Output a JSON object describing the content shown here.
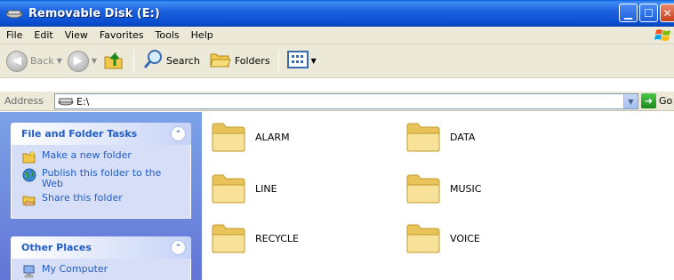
{
  "window": {
    "title": "Removable Disk (E:)",
    "icon": "removable-disk-icon",
    "controls": [
      "minimize",
      "maximize",
      "close"
    ]
  },
  "menu": {
    "items": [
      "File",
      "Edit",
      "View",
      "Favorites",
      "Tools",
      "Help"
    ]
  },
  "toolbar": {
    "back_label": "Back",
    "search_label": "Search",
    "folders_label": "Folders"
  },
  "address": {
    "label": "Address",
    "value": "E:\\",
    "go_label": "Go"
  },
  "left_pane": {
    "file_tasks": {
      "title": "File and Folder Tasks",
      "items": [
        {
          "label": "Make a new folder",
          "icon": "new-folder-icon"
        },
        {
          "label": "Publish this folder to the Web",
          "icon": "globe-icon"
        },
        {
          "label": "Share this folder",
          "icon": "share-folder-icon"
        }
      ]
    },
    "other_places": {
      "title": "Other Places",
      "items": [
        {
          "label": "My Computer",
          "icon": "my-computer-icon"
        }
      ]
    }
  },
  "folders": [
    {
      "name": "ALARM"
    },
    {
      "name": "DATA"
    },
    {
      "name": "LINE"
    },
    {
      "name": "MUSIC"
    },
    {
      "name": "RECYCLE"
    },
    {
      "name": "VOICE"
    }
  ],
  "colors": {
    "title_bar": "#0a4ed0",
    "task_pane": "#6375d6",
    "link": "#215dc6",
    "folder": "#f5d97a"
  }
}
